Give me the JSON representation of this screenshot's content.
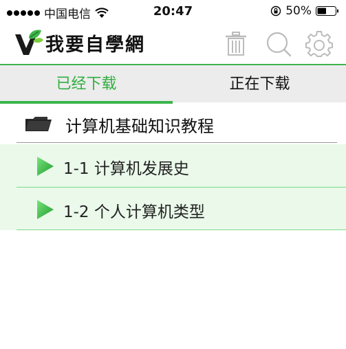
{
  "status_bar": {
    "carrier": "中国电信",
    "time": "20:47",
    "battery_percent": "50%",
    "battery_level": 0.5
  },
  "app": {
    "logo_text": "我要自學網"
  },
  "header_icons": [
    "trash-icon",
    "search-icon",
    "gear-icon"
  ],
  "tabs": [
    {
      "label": "已经下载",
      "active": true
    },
    {
      "label": "正在下载",
      "active": false
    }
  ],
  "course": {
    "title": "计算机基础知识教程",
    "lessons": [
      {
        "label": "1-1 计算机发展史"
      },
      {
        "label": "1-2 个人计算机类型"
      }
    ]
  },
  "colors": {
    "accent": "#3ab54a",
    "tab_bar_bg": "#ececec",
    "lesson_bg": "#eaf9ea"
  }
}
